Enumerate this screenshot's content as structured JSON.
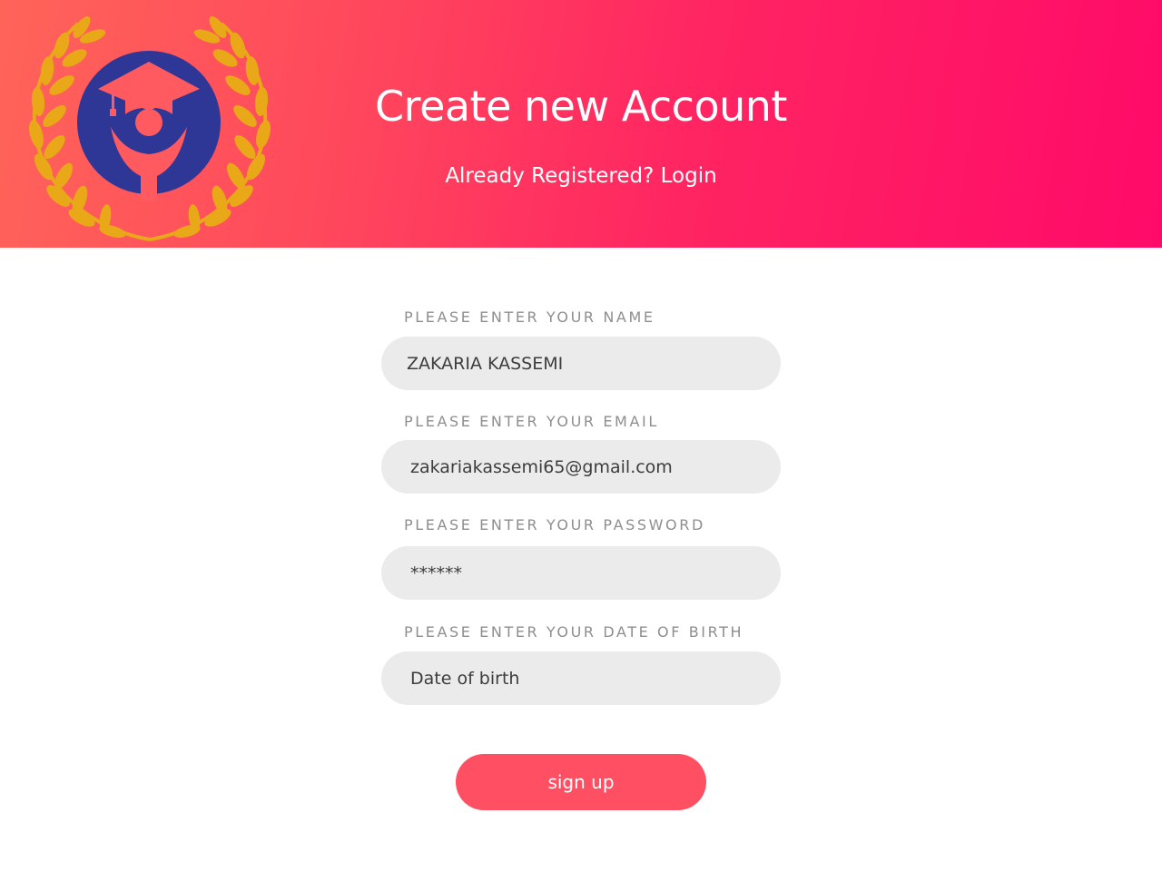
{
  "colors": {
    "header_gradient_start": "#ff6459",
    "header_gradient_end": "#ff0a69",
    "logo_blue": "#2f3796",
    "logo_gold": "#e9a818",
    "input_background": "#ebebeb",
    "label_text": "#8e8e8e",
    "button_background": "#ff5063"
  },
  "header": {
    "logo_icon": "graduate-laurel-logo-icon",
    "title": "Create new Account",
    "login_link": "Already Registered? Login"
  },
  "form": {
    "name": {
      "label": "PLEASE ENTER YOUR NAME",
      "value": "ZAKARIA KASSEMI"
    },
    "email": {
      "label": "PLEASE ENTER YOUR EMAIL",
      "value": "zakariakassemi65@gmail.com"
    },
    "password": {
      "label": "PLEASE ENTER YOUR PASSWORD",
      "value": "******"
    },
    "dob": {
      "label": "PLEASE ENTER YOUR DATE OF BIRTH",
      "placeholder": "Date of birth"
    },
    "submit_label": "sign up"
  }
}
